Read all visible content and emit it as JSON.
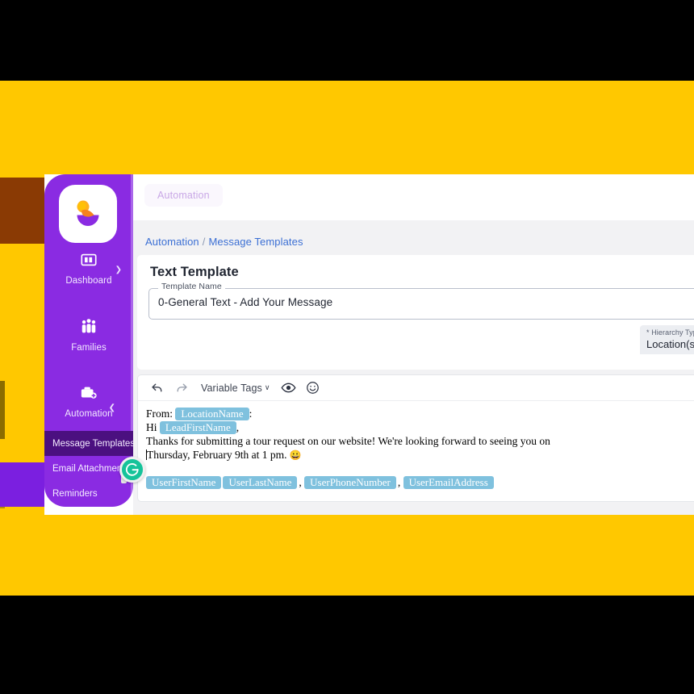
{
  "colors": {
    "background_band": "#FFC800",
    "sidebar": "#8A2BE2",
    "sidebar_active": "#4B1080",
    "accent_brown": "#8A3A04",
    "accent_purple": "#7B1FE0",
    "variable_tag": "#7FC1DE",
    "breadcrumb_link": "#3B6FD4",
    "grammarly_green": "#15C39A"
  },
  "sidebar": {
    "logo_name": "app-logo",
    "items": [
      {
        "label": "Dashboard",
        "icon": "dashboard-icon",
        "expander": "chevron-right"
      },
      {
        "label": "Families",
        "icon": "families-icon",
        "expander": ""
      },
      {
        "label": "Automation",
        "icon": "automation-briefcase-icon",
        "expander": "chevron-down"
      }
    ],
    "sub_items": [
      {
        "label": "Message Templates",
        "active": true
      },
      {
        "label": "Email Attachments",
        "active": false
      },
      {
        "label": "Reminders",
        "active": false
      }
    ]
  },
  "topbar": {
    "tab_label": "Automation"
  },
  "breadcrumb": {
    "root": "Automation",
    "separator": "/",
    "current": "Message Templates"
  },
  "card": {
    "title": "Text Template",
    "template_name_label": "Template Name",
    "template_name_value": "0-General Text - Add Your Message",
    "hierarchy_label": "* Hierarchy Type",
    "hierarchy_value": "Location(s)"
  },
  "editor": {
    "toolbar": {
      "undo": "undo-icon",
      "redo": "redo-icon",
      "variable_tags_label": "Variable Tags",
      "variable_tags_caret": "∨",
      "preview": "eye-icon",
      "emoji": "emoji-icon"
    },
    "message": {
      "line1_prefix": "From:",
      "line1_tag": "LocationName",
      "line1_suffix": ":",
      "line2_prefix": "Hi",
      "line2_tag": "LeadFirstName",
      "line2_suffix": ",",
      "line3": "Thanks for submitting a tour request on our website! We're looking forward to seeing you on",
      "line4": "Thursday, February 9th at 1 pm.",
      "line4_emoji": "😀"
    },
    "tags": [
      "UserFirstName",
      "UserLastName",
      "UserPhoneNumber",
      "UserEmailAddress"
    ],
    "tag_separators": [
      "",
      ",",
      ",",
      ""
    ]
  },
  "overlay": {
    "grammarly_label": "grammarly-button"
  }
}
